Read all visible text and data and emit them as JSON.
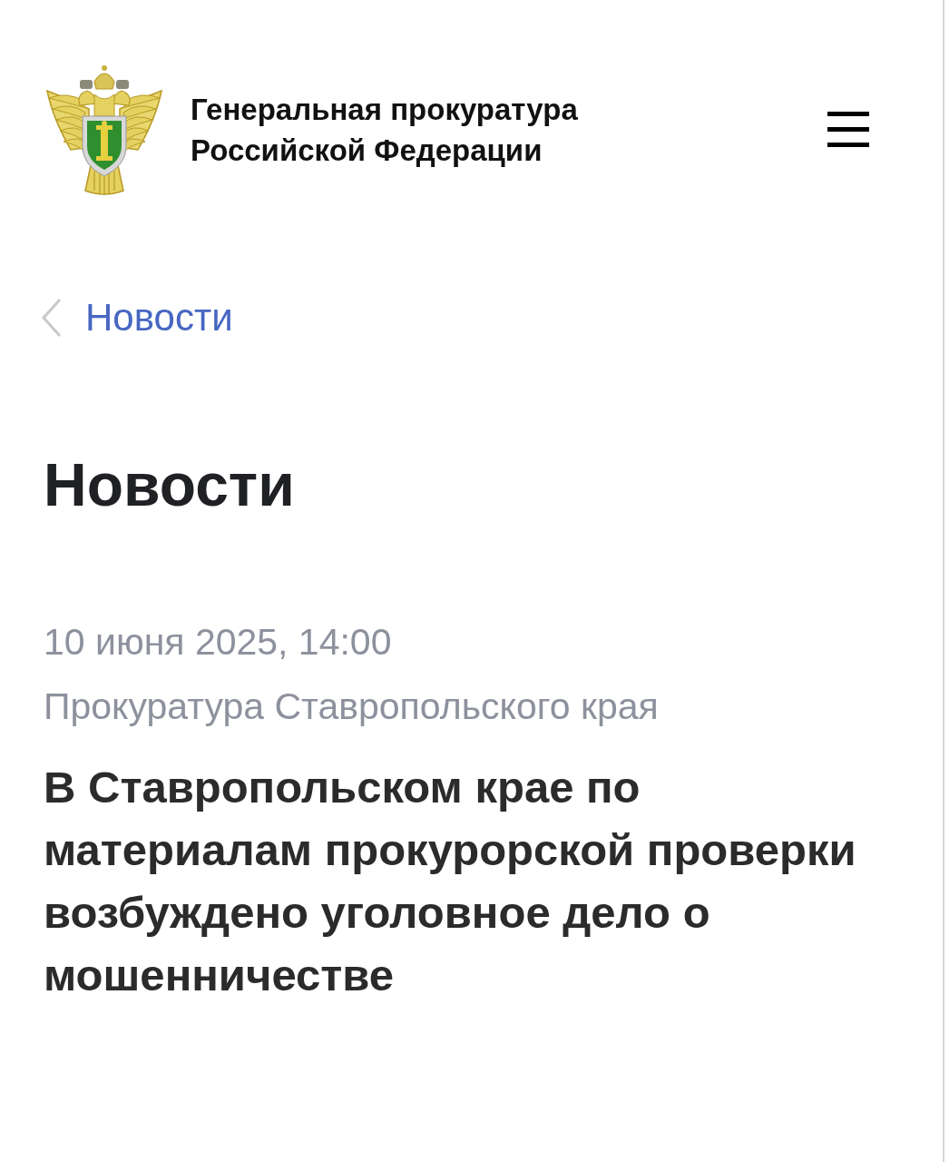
{
  "header": {
    "title": "Генеральная прокуратура Российской Федерации"
  },
  "back_link": {
    "label": "Новости"
  },
  "page_title": "Новости",
  "article": {
    "date": "10 июня 2025, 14:00",
    "source": "Прокуратура Ставропольского края",
    "headline": "В Ставропольском крае по материалам прокурорской проверки возбуждено уголовное дело о мошенничестве"
  }
}
